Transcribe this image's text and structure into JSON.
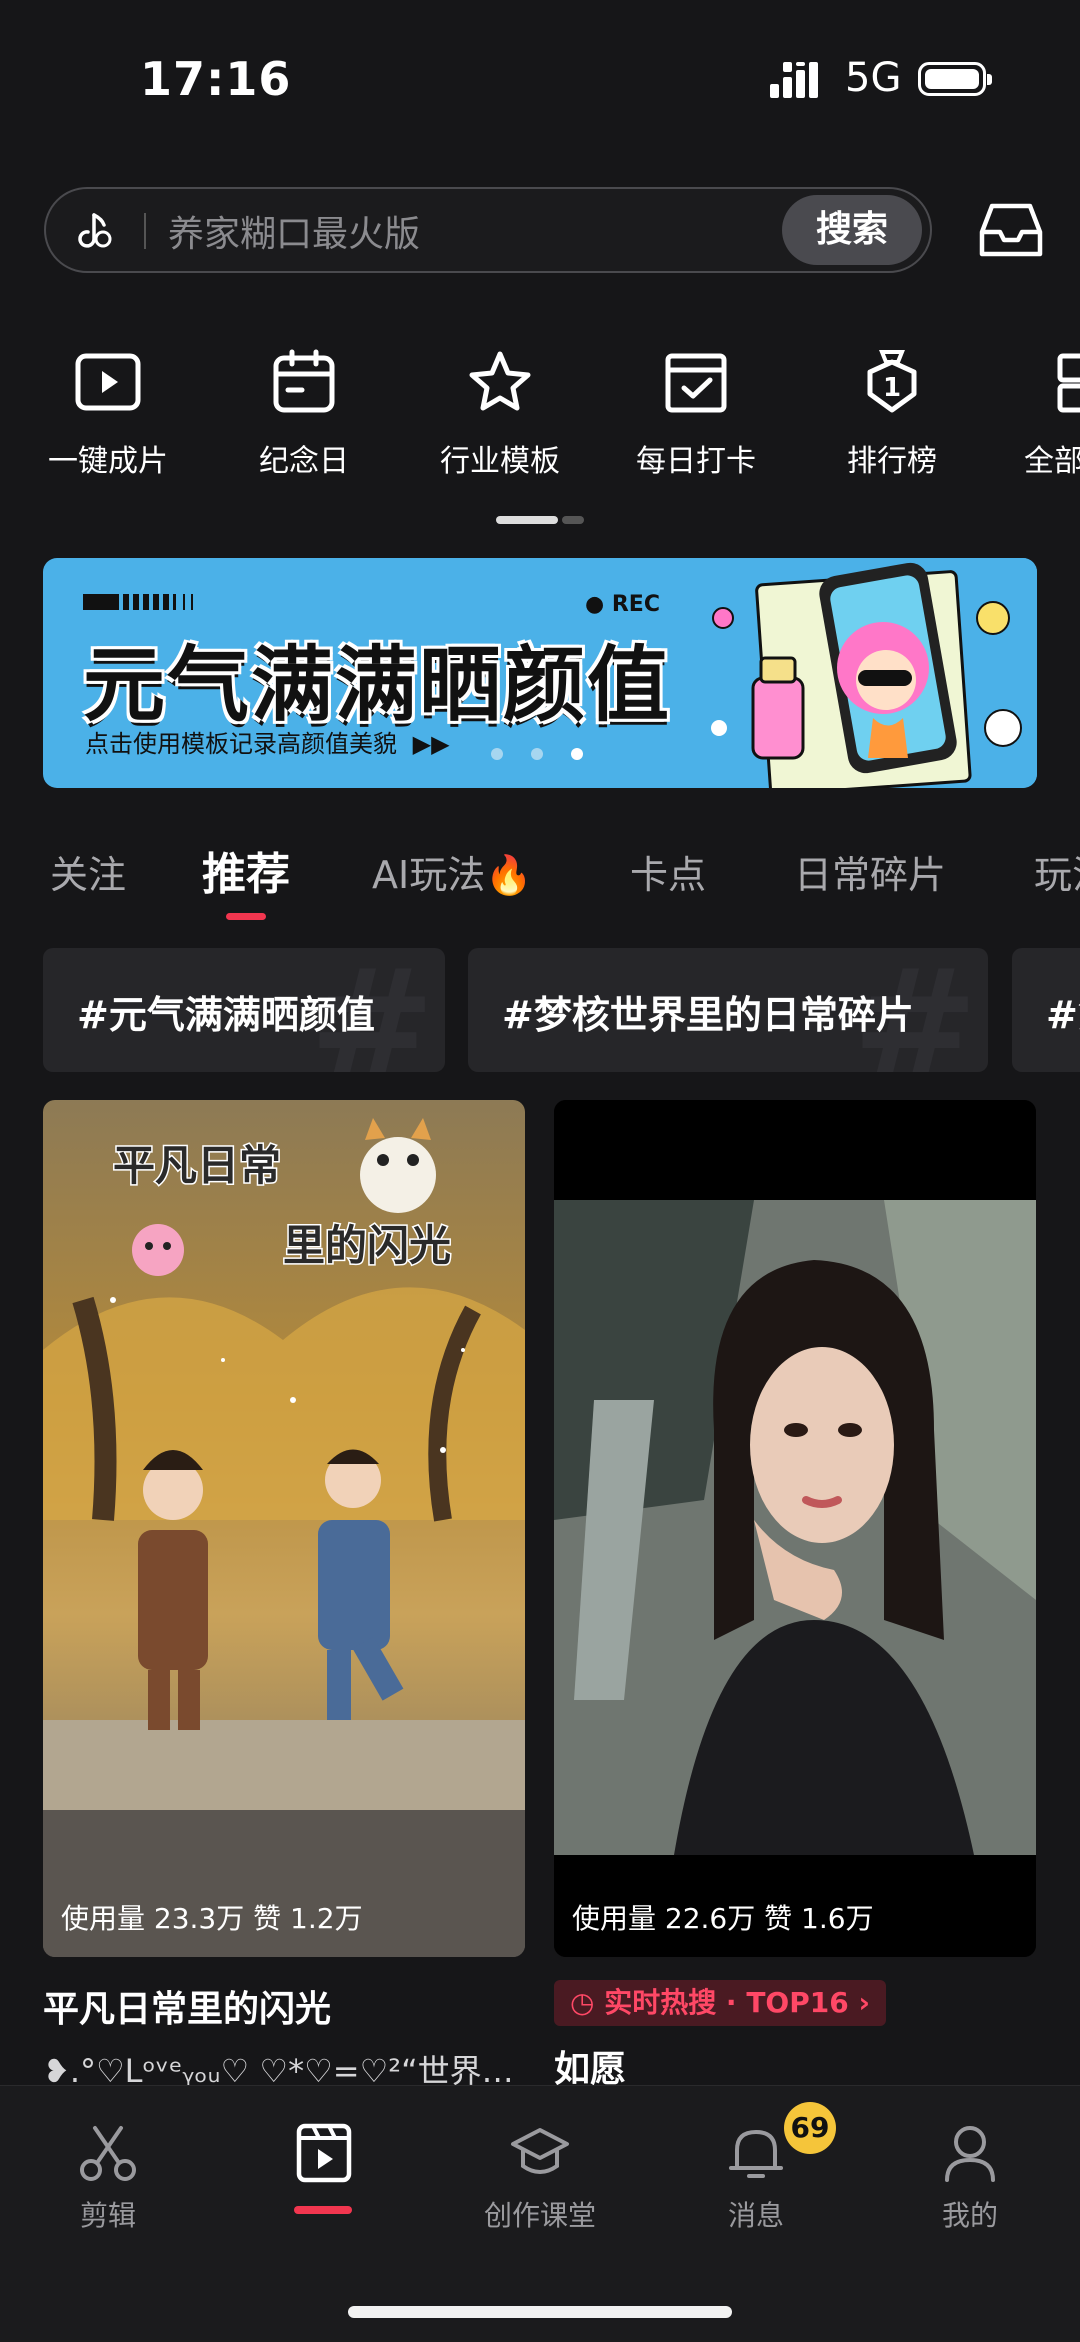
{
  "status_bar": {
    "time": "17:16",
    "network": "5G"
  },
  "search": {
    "placeholder": "养家糊口最火版",
    "button_label": "搜索"
  },
  "shortcuts": [
    {
      "label": "一键成片",
      "icon": "play-square-icon"
    },
    {
      "label": "纪念日",
      "icon": "calendar-icon"
    },
    {
      "label": "行业模板",
      "icon": "star-icon"
    },
    {
      "label": "每日打卡",
      "icon": "check-calendar-icon"
    },
    {
      "label": "排行榜",
      "icon": "medal-icon"
    },
    {
      "label": "全部",
      "icon": "grid-icon"
    }
  ],
  "banner": {
    "title": "元气满满晒颜值",
    "subtitle": "点击使用模板记录高颜值美貌",
    "rec_label": "● REC",
    "arrow": "▶▶",
    "page_count": 3,
    "active_page": 3
  },
  "tabs": [
    {
      "label": "关注"
    },
    {
      "label": "推荐",
      "active": true
    },
    {
      "label": "AI玩法🔥"
    },
    {
      "label": "卡点"
    },
    {
      "label": "日常碎片"
    },
    {
      "label": "玩法"
    }
  ],
  "hashtags": [
    "#元气满满晒颜值",
    "#梦核世界里的日常碎片",
    "#第"
  ],
  "cards": [
    {
      "usage": "使用量 23.3万  赞 1.2万",
      "title": "平凡日常里的闪光",
      "subtitle": "❥.°♡Lᵒᵛᵉᵧₒᵤ♡ ♡*♡=♡²“世界…",
      "overlay_text_1": "平凡日常",
      "overlay_text_2": "里的闪光"
    },
    {
      "usage": "使用量 22.6万  赞 1.6万",
      "hot_tag": "实时热搜 · TOP16",
      "title": "如愿"
    }
  ],
  "bottom_nav": [
    {
      "label": "剪辑",
      "icon": "scissors-icon"
    },
    {
      "label": "",
      "icon": "template-icon",
      "active": true
    },
    {
      "label": "创作课堂",
      "icon": "graduation-cap-icon"
    },
    {
      "label": "消息",
      "icon": "bell-icon",
      "badge": "69"
    },
    {
      "label": "我的",
      "icon": "person-icon"
    }
  ],
  "colors": {
    "accent": "#f2364f",
    "background": "#161618",
    "banner": "#4bb1e8",
    "badge": "#f5c53a"
  }
}
